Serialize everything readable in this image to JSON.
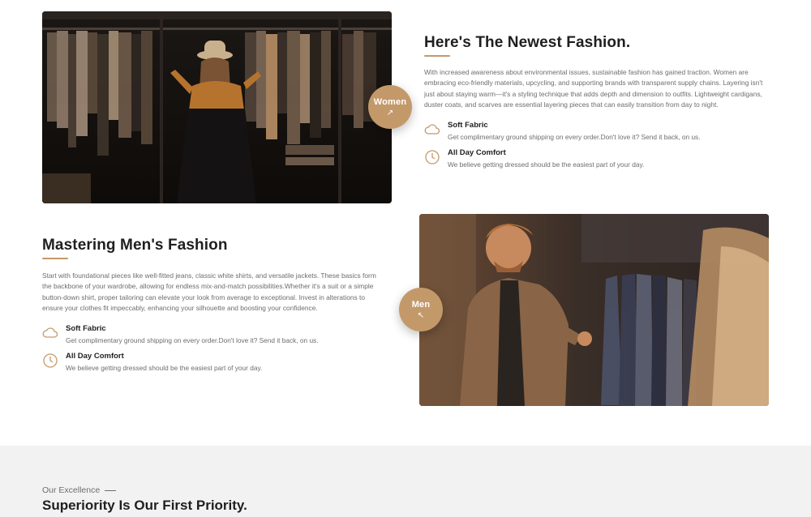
{
  "women": {
    "badge_label": "Women",
    "badge_arrow": "↗",
    "title": "Here's The Newest Fashion.",
    "description": "With increased awareness about environmental issues, sustainable fashion has gained traction. Women are embracing eco-friendly materials, upcycling, and supporting brands with transparent supply chains. Layering isn't just about staying warm—it's a styling technique that adds depth and dimension to outfits. Lightweight cardigans, duster coats, and scarves are essential layering pieces that can easily transition from day to night.",
    "features": [
      {
        "icon": "cloud-icon",
        "title": "Soft Fabric",
        "text": "Get complimentary ground shipping on every order.Don't love it? Send it back, on us."
      },
      {
        "icon": "clock-icon",
        "title": "All Day Comfort",
        "text": "We believe getting dressed should be the easiest part of your day."
      }
    ]
  },
  "men": {
    "badge_label": "Men",
    "badge_arrow": "↖",
    "title": "Mastering Men's Fashion",
    "description": "Start with foundational pieces like well-fitted jeans, classic white shirts, and versatile jackets. These basics form the backbone of your wardrobe, allowing for endless mix-and-match possibilities.Whether it's a suit or a simple button-down shirt, proper tailoring can elevate your look from average to exceptional. Invest in alterations to ensure your clothes fit impeccably, enhancing your silhouette and boosting your confidence.",
    "features": [
      {
        "icon": "cloud-icon",
        "title": "Soft Fabric",
        "text": "Get complimentary ground shipping on every order.Don't love it? Send it back, on us."
      },
      {
        "icon": "clock-icon",
        "title": "All Day Comfort",
        "text": "We believe getting dressed should be the easiest part of your day."
      }
    ]
  },
  "excellence": {
    "kicker": "Our Excellence",
    "heading": "Superiority Is Our First Priority."
  },
  "colors": {
    "accent": "#c4996a",
    "heading": "#1f1f1f",
    "body": "#6d6d6d",
    "band": "#f2f2f2"
  }
}
